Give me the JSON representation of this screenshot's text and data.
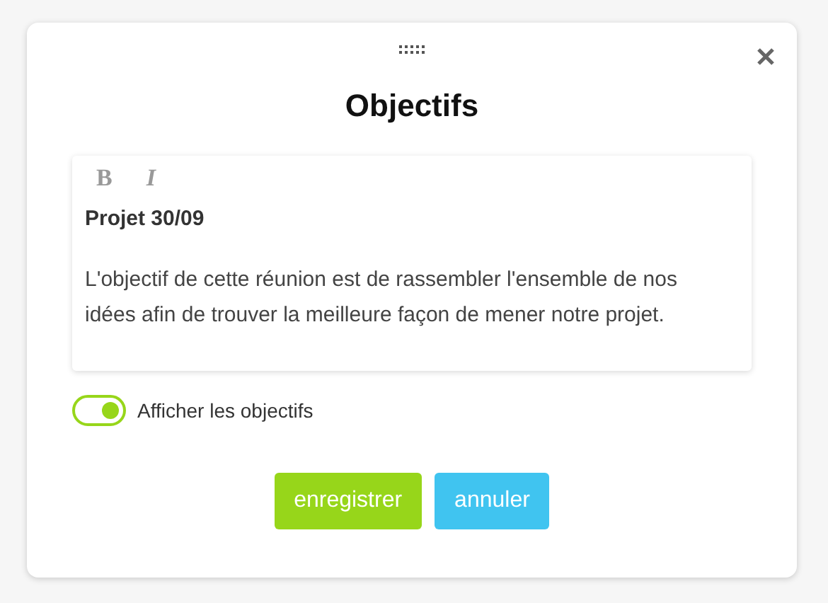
{
  "dialog": {
    "title": "Objectifs"
  },
  "toolbar": [
    {
      "label": "B",
      "kind": "bold"
    },
    {
      "label": "I",
      "kind": "italic"
    }
  ],
  "editor": {
    "heading": "Projet 30/09",
    "body": "L'objectif de cette réunion est de rassembler l'ensemble de nos idées afin de trouver la meilleure façon de mener notre projet."
  },
  "toggle": {
    "label": "Afficher les objectifs",
    "on": true
  },
  "buttons": [
    {
      "label": "enregistrer",
      "kind": "primary"
    },
    {
      "label": "annuler",
      "kind": "secondary"
    }
  ]
}
